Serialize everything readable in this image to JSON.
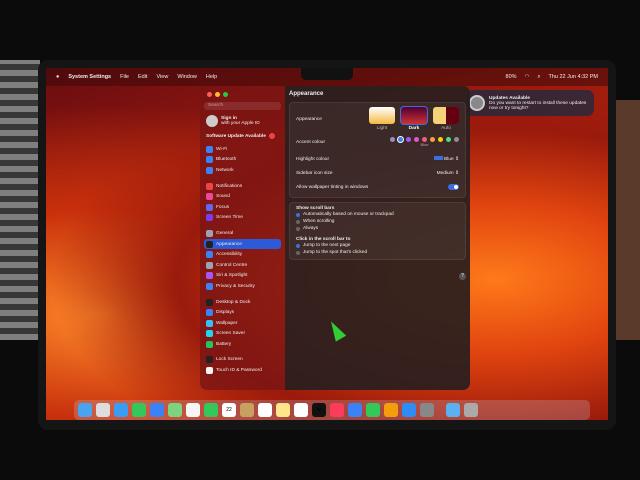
{
  "menubar": {
    "apple": "",
    "app": "System Settings",
    "menus": [
      "File",
      "Edit",
      "View",
      "Window",
      "Help"
    ],
    "battery": "80%",
    "datetime": "Thu 22 Jun  4:32 PM"
  },
  "notification": {
    "title": "Updates Available",
    "body": "Do you want to restart to install these updates now or try tonight?"
  },
  "sidebar": {
    "search_placeholder": "Search",
    "sign_in": "Sign in",
    "sign_in_sub": "with your Apple ID",
    "software_update": "Software Update Available",
    "update_count": "1",
    "groups": [
      [
        {
          "label": "Wi-Fi",
          "color": "#3b82f6"
        },
        {
          "label": "Bluetooth",
          "color": "#3b82f6"
        },
        {
          "label": "Network",
          "color": "#3b82f6"
        }
      ],
      [
        {
          "label": "Notifications",
          "color": "#ef4444"
        },
        {
          "label": "Sound",
          "color": "#ec4899"
        },
        {
          "label": "Focus",
          "color": "#6366f1"
        },
        {
          "label": "Screen Time",
          "color": "#7c3aed"
        }
      ],
      [
        {
          "label": "General",
          "color": "#9ca3af"
        },
        {
          "label": "Appearance",
          "color": "#222",
          "selected": true
        },
        {
          "label": "Accessibility",
          "color": "#3b82f6"
        },
        {
          "label": "Control Centre",
          "color": "#9ca3af"
        },
        {
          "label": "Siri & Spotlight",
          "color": "#a855f7"
        },
        {
          "label": "Privacy & Security",
          "color": "#3b82f6"
        }
      ],
      [
        {
          "label": "Desktop & Dock",
          "color": "#222"
        },
        {
          "label": "Displays",
          "color": "#3b82f6"
        },
        {
          "label": "Wallpaper",
          "color": "#38bdf8"
        },
        {
          "label": "Screen Saver",
          "color": "#22d3ee"
        },
        {
          "label": "Battery",
          "color": "#22c55e"
        }
      ],
      [
        {
          "label": "Lock Screen",
          "color": "#222"
        },
        {
          "label": "Touch ID & Password",
          "color": "#f3f4f6"
        }
      ]
    ]
  },
  "main": {
    "title": "Appearance",
    "appearance_label": "Appearance",
    "modes": [
      {
        "label": "Light"
      },
      {
        "label": "Dark",
        "selected": true
      },
      {
        "label": "Auto"
      }
    ],
    "accent_label": "Accent colour",
    "accent_selected": "Blue",
    "accent_colors": [
      "#9b8ac4",
      "#3b82f6",
      "#a855f7",
      "#e056c8",
      "#f0607a",
      "#f59e42",
      "#facc15",
      "#4ade80",
      "#8e8e93"
    ],
    "highlight_label": "Highlight colour",
    "highlight_value": "Blue",
    "icon_size_label": "Sidebar icon size",
    "icon_size_value": "Medium",
    "tinting_label": "Allow wallpaper tinting in windows",
    "tinting_on": true,
    "scroll_label": "Show scroll bars",
    "scroll_options": [
      "Automatically based on mouse or trackpad",
      "When scrolling",
      "Always"
    ],
    "scroll_selected": 0,
    "click_label": "Click in the scroll bar to",
    "click_options": [
      "Jump to the next page",
      "Jump to the spot that's clicked"
    ],
    "click_selected": 0,
    "help": "?"
  },
  "dock": [
    {
      "name": "finder",
      "c": "#4aa3f0"
    },
    {
      "name": "launchpad",
      "c": "#ddd"
    },
    {
      "name": "safari",
      "c": "#3b9cf5"
    },
    {
      "name": "messages",
      "c": "#34c759"
    },
    {
      "name": "mail",
      "c": "#3b82f6"
    },
    {
      "name": "maps",
      "c": "#7ed37e"
    },
    {
      "name": "photos",
      "c": "#f5f5f5"
    },
    {
      "name": "facetime",
      "c": "#34c759"
    },
    {
      "name": "calendar",
      "c": "#fff",
      "t": "22"
    },
    {
      "name": "contacts",
      "c": "#c8a060"
    },
    {
      "name": "reminders",
      "c": "#fff"
    },
    {
      "name": "notes",
      "c": "#fde68a"
    },
    {
      "name": "freeform",
      "c": "#fff"
    },
    {
      "name": "tv",
      "c": "#111",
      "t": "tv"
    },
    {
      "name": "music",
      "c": "#fb3c5b"
    },
    {
      "name": "keynote",
      "c": "#3b82f6"
    },
    {
      "name": "numbers",
      "c": "#34c759"
    },
    {
      "name": "pages",
      "c": "#f59e0b"
    },
    {
      "name": "app-store",
      "c": "#2f8bf5"
    },
    {
      "name": "system-settings",
      "c": "#888"
    },
    {
      "name": "downloads-folder",
      "c": "#5ab0f0"
    },
    {
      "name": "trash",
      "c": "#aaa"
    }
  ]
}
